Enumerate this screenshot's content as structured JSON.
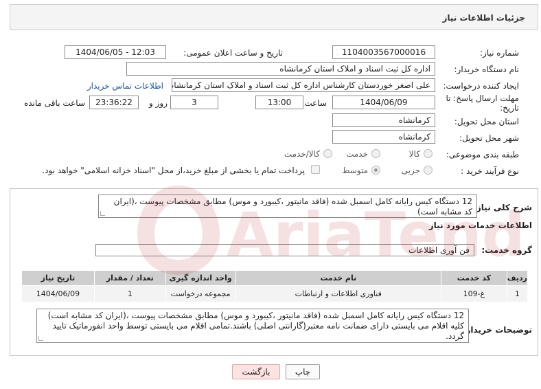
{
  "header": {
    "title": "جزئیات اطلاعات نیاز"
  },
  "form": {
    "need_number_label": "شماره نیاز:",
    "need_number": "1104003567000016",
    "announce_label": "تاریخ و ساعت اعلان عمومی:",
    "announce_value": "1404/06/05 - 12:03",
    "buyer_label": "نام دستگاه خریدار:",
    "buyer_value": "اداره کل ثبت اسناد و املاک استان کرمانشاه",
    "creator_label": "ایجاد کننده درخواست:",
    "creator_value": "علی اصغر خوردستان کارشناس اداره کل ثبت اسناد و املاک استان کرمانشاه",
    "contact_link": "اطلاعات تماس خریدار",
    "deadline_label_1": "مهلت ارسال پاسخ: تا",
    "deadline_label_2": "تاریخ:",
    "deadline_date": "1404/06/09",
    "time_label": "ساعت",
    "deadline_time": "13:00",
    "days_value": "3",
    "days_label": "روز و",
    "remaining_time": "23:36:22",
    "remaining_label": "ساعت باقی مانده",
    "province_label": "استان محل تحویل:",
    "province_value": "کرمانشاه",
    "city_label": "شهر محل تحویل:",
    "city_value": "کرمانشاه",
    "category_label": "طبقه بندی موضوعی:",
    "category_options": [
      "کالا",
      "خدمت",
      "کالا/خدمت"
    ],
    "category_selected": "خدمت",
    "process_label": "نوع فرآیند خرید :",
    "process_options": [
      "جزیی",
      "متوسط"
    ],
    "process_selected": "متوسط",
    "payment_note": "پرداخت تمام یا بخشی از مبلغ خرید،از محل \"اسناد خزانه اسلامی\" خواهد بود."
  },
  "main": {
    "summary_label": "شرح کلی نیاز:",
    "summary_text": "12 دستگاه کیس رایانه کامل اسمبل شده (فاقد مانیتور ،کیبورد و موس) مطابق مشخصات پیوست ،(ایران کد مشابه است)",
    "services_title": "اطلاعات خدمات مورد نیاز",
    "service_group_label": "گروه خدمت:",
    "service_group_value": "فن آوری اطلاعات",
    "table": {
      "headers": [
        "ردیف",
        "کد خدمت",
        "نام خدمت",
        "واحد اندازه گیری",
        "تعداد / مقدار",
        "تاریخ نیاز"
      ],
      "rows": [
        [
          "1",
          "غ-109",
          "فناوری اطلاعات و ارتباطات",
          "مجموعه درخواست",
          "1",
          "1404/06/09"
        ]
      ]
    },
    "buyer_notes_label": "توضیحات خریدار:",
    "buyer_notes_text": "12 دستگاه کیس رایانه کامل اسمبل شده (فاقد مانیتور ،کیبورد و موس) مطابق مشخصات پیوست ،(ایران کد مشابه است) کلیه اقلام می بایستی دارای ضمانت نامه معتبر(گارانتی اصلی) باشند.تمامی اقلام می بایستی توسط واحد انفورماتیک تایید گردد."
  },
  "actions": {
    "print_label": "چاپ",
    "back_label": "بازگشت"
  },
  "watermark": {
    "text": "AriaTender.net"
  },
  "colors": {
    "link": "#1a55b3",
    "back_button": "#fde2e2",
    "table_header": "#cfcfcf"
  }
}
